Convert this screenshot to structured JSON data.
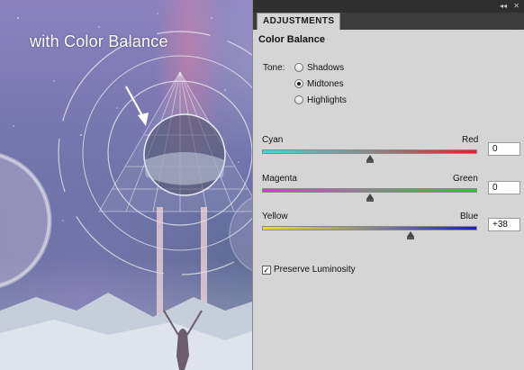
{
  "artwork": {
    "caption": "with Color Balance"
  },
  "panel": {
    "tab_label": "ADJUSTMENTS",
    "title": "Color Balance",
    "tone_label": "Tone:",
    "tones": [
      {
        "label": "Shadows",
        "selected": false
      },
      {
        "label": "Midtones",
        "selected": true
      },
      {
        "label": "Highlights",
        "selected": false
      }
    ],
    "sliders": [
      {
        "left_label": "Cyan",
        "right_label": "Red",
        "value": "0",
        "level": 0,
        "colors": [
          "#3fd6d6",
          "#e02020"
        ]
      },
      {
        "left_label": "Magenta",
        "right_label": "Green",
        "value": "0",
        "level": 0,
        "colors": [
          "#e030e0",
          "#20d020"
        ]
      },
      {
        "left_label": "Yellow",
        "right_label": "Blue",
        "value": "+38",
        "level": 38,
        "colors": [
          "#e8e020",
          "#1a1ad8"
        ]
      }
    ],
    "preserve_luminosity": {
      "label": "Preserve Luminosity",
      "checked": true
    }
  }
}
